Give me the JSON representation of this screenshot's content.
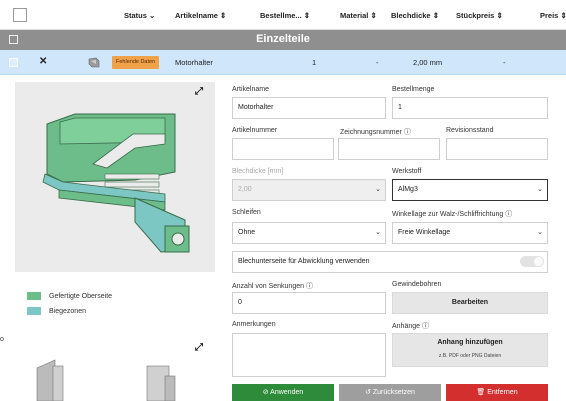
{
  "header": {
    "columns": [
      "Status",
      "Artikelname",
      "Bestellme...",
      "Material",
      "Blechdicke",
      "Stückpreis",
      "Preis"
    ]
  },
  "group": {
    "title": "Einzelteile"
  },
  "row": {
    "remove_icon": "✕",
    "badge": "Fehlende Daten",
    "name": "Motorhalter",
    "quantity": "1",
    "material": "-",
    "thickness": "2,00 mm",
    "unit_price": "-"
  },
  "legend": [
    {
      "label": "Gefertigte Oberseite",
      "color": "#6dbd8a"
    },
    {
      "label": "Biegezonen",
      "color": "#7cc7c4"
    }
  ],
  "form": {
    "artikelname": {
      "label": "Artikelname",
      "value": "Motorhalter"
    },
    "bestellmenge": {
      "label": "Bestellmenge",
      "value": "1"
    },
    "artikelnummer": {
      "label": "Artikelnummer",
      "value": ""
    },
    "zeichnungsnummer": {
      "label": "Zeichnungsnummer",
      "value": ""
    },
    "revisionsstand": {
      "label": "Revisionsstand",
      "value": ""
    },
    "blechdicke": {
      "label": "Blechdicke [mm]",
      "value": "2,00"
    },
    "werkstoff": {
      "label": "Werkstoff",
      "value": "AlMg3"
    },
    "schleifen": {
      "label": "Schleifen",
      "value": "Ohne"
    },
    "winkellage": {
      "label": "Winkellage zur Walz-/Schliffrichtung",
      "value": "Freie Winkellage"
    },
    "blechunterseite": {
      "label": "Blechunterseite für Abwicklung verwenden"
    },
    "senkungen": {
      "label": "Anzahl von Senkungen",
      "value": "0"
    },
    "gewinde": {
      "label": "Gewindebohren",
      "button": "Bearbeiten"
    },
    "anmerkungen": {
      "label": "Anmerkungen",
      "value": ""
    },
    "anhaenge": {
      "label": "Anhänge",
      "button": "Anhang hinzufügen",
      "hint": "z.B. PDF oder PNG Dateien"
    }
  },
  "footer": {
    "apply": "Anwenden",
    "reset": "Zurücksetzen",
    "remove": "Entfernen",
    "colors": {
      "apply": "#2e8b3a",
      "reset": "#9e9e9e",
      "remove": "#d32f2f"
    }
  },
  "left_edge_glyph": "o"
}
